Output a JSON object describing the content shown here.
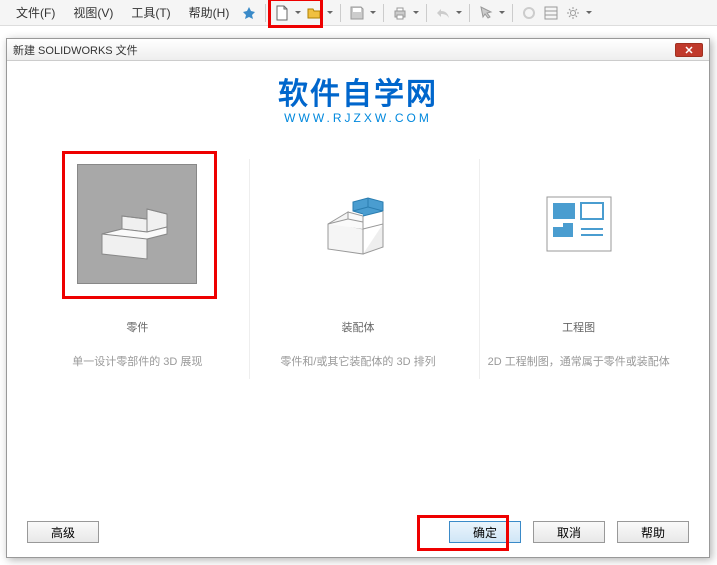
{
  "menu": {
    "file": "文件(F)",
    "view": "视图(V)",
    "tools": "工具(T)",
    "help": "帮助(H)"
  },
  "dialog": {
    "title": "新建 SOLIDWORKS 文件"
  },
  "logo": {
    "main": "软件自学网",
    "sub": "WWW.RJZXW.COM"
  },
  "options": {
    "part": {
      "label": "零件",
      "desc": "单一设计零部件的 3D 展现"
    },
    "assembly": {
      "label": "装配体",
      "desc": "零件和/或其它装配体的 3D 排列"
    },
    "drawing": {
      "label": "工程图",
      "desc": "2D 工程制图，通常属于零件或装配体"
    }
  },
  "buttons": {
    "advanced": "高级",
    "ok": "确定",
    "cancel": "取消",
    "help": "帮助"
  }
}
